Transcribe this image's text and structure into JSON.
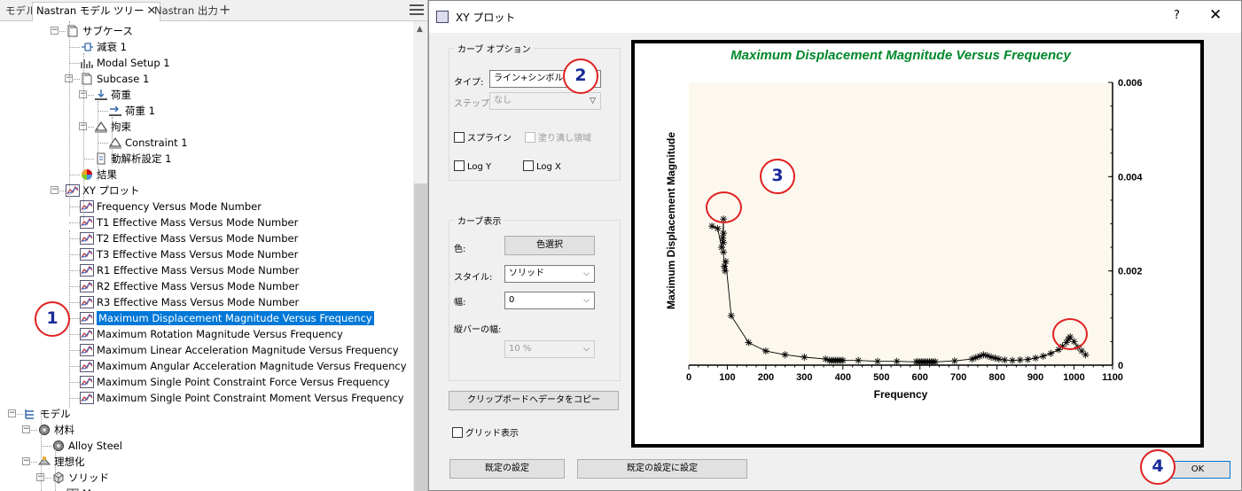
{
  "tabs": [
    {
      "label": "モデル"
    },
    {
      "label": "Nastran モデル ツリー",
      "close": "✕"
    },
    {
      "label": "Nastran 出力"
    }
  ],
  "tab_add": "+",
  "tree": [
    {
      "label": "サブケース",
      "icon": "subcase-icon"
    },
    {
      "label": "減衰 1",
      "icon": "damping-icon"
    },
    {
      "label": "Modal Setup 1",
      "icon": "modal-setup-icon"
    },
    {
      "label": "Subcase 1",
      "icon": "subcase-icon"
    },
    {
      "label": "荷重",
      "icon": "load-icon"
    },
    {
      "label": "荷重 1",
      "icon": "load-item-icon"
    },
    {
      "label": "拘束",
      "icon": "constraint-icon"
    },
    {
      "label": "Constraint 1",
      "icon": "constraint-item-icon"
    },
    {
      "label": "動解析設定 1",
      "icon": "dynamic-settings-icon"
    },
    {
      "label": "結果",
      "icon": "results-icon"
    },
    {
      "label": "XY プロット",
      "icon": "xy-plot-icon"
    },
    {
      "label": "Frequency Versus Mode Number",
      "icon": "plot-icon"
    },
    {
      "label": "T1 Effective Mass Versus Mode Number",
      "icon": "plot-icon"
    },
    {
      "label": "T2 Effective Mass Versus Mode Number",
      "icon": "plot-icon"
    },
    {
      "label": "T3 Effective Mass Versus Mode Number",
      "icon": "plot-icon"
    },
    {
      "label": "R1 Effective Mass Versus Mode Number",
      "icon": "plot-icon"
    },
    {
      "label": "R2 Effective Mass Versus Mode Number",
      "icon": "plot-icon"
    },
    {
      "label": "R3 Effective Mass Versus Mode Number",
      "icon": "plot-icon"
    },
    {
      "label": "Maximum Displacement Magnitude Versus Frequency",
      "icon": "plot-icon",
      "selected": true
    },
    {
      "label": "Maximum Rotation Magnitude Versus Frequency",
      "icon": "plot-icon"
    },
    {
      "label": "Maximum Linear Acceleration Magnitude Versus Frequency",
      "icon": "plot-icon"
    },
    {
      "label": "Maximum Angular Acceleration Magnitude Versus Frequency",
      "icon": "plot-icon"
    },
    {
      "label": "Maximum Single Point Constraint Force Versus Frequency",
      "icon": "plot-icon"
    },
    {
      "label": "Maximum Single Point Constraint Moment Versus Frequency",
      "icon": "plot-icon"
    },
    {
      "label": "モデル",
      "icon": "model-icon"
    },
    {
      "label": "材料",
      "icon": "materials-icon"
    },
    {
      "label": "Alloy Steel",
      "icon": "material-icon"
    },
    {
      "label": "理想化",
      "icon": "idealization-icon"
    },
    {
      "label": "ソリッド",
      "icon": "solid-icon"
    },
    {
      "label": "M",
      "icon": "mesh-icon"
    }
  ],
  "dialog": {
    "title": "XY プロット",
    "help": "?",
    "close": "✕",
    "curve_options": {
      "title": "カーブ オプション",
      "type_label": "タイプ:",
      "type_value": "ライン+シンボル",
      "step_label": "ステップ:",
      "step_value": "なし",
      "spline": "スプライン",
      "fill_area": "塗り潰し領域",
      "log_y": "Log Y",
      "log_x": "Log X"
    },
    "curve_display": {
      "title": "カーブ表示",
      "color_label": "色:",
      "color_button": "色選択",
      "style_label": "スタイル:",
      "style_value": "ソリッド",
      "width_label": "幅:",
      "width_value": "0",
      "errbar_label": "縦バーの幅:",
      "errbar_value": "10 %",
      "copy_button": "クリップボードへデータをコピー"
    },
    "grid_label": "グリッド表示",
    "default_settings": "既定の設定",
    "set_as_default": "既定の設定に設定",
    "ok": "OK"
  },
  "callouts": [
    "1",
    "2",
    "3",
    "4"
  ],
  "colors": {
    "title_green": "#00882b",
    "plot_bg": "#fcf8ee",
    "selection": "#0078d7",
    "callout_ring": "#e02020",
    "callout_text": "#1a2a9a"
  },
  "chart_data": {
    "type": "line",
    "title": "Maximum Displacement Magnitude Versus Frequency",
    "xlabel": "Frequency",
    "ylabel": "Maximum Displacement Magnitude",
    "xlim": [
      0,
      1100
    ],
    "ylim": [
      0,
      0.006
    ],
    "xticks": [
      "0",
      "100",
      "200",
      "300",
      "400",
      "500",
      "600",
      "700",
      "800",
      "900",
      "1000",
      "1100"
    ],
    "yticks": [
      "0",
      "0.002",
      "0.004",
      "0.006"
    ],
    "y_axis_side": "right",
    "marker": "asterisk",
    "grid": false,
    "series": [
      {
        "x": [
          60,
          75,
          85,
          88,
          90,
          90,
          90,
          90,
          92,
          94,
          96,
          110,
          155,
          200,
          250,
          300,
          355,
          365,
          370,
          375,
          380,
          385,
          390,
          395,
          400,
          440,
          490,
          540,
          590,
          595,
          600,
          605,
          610,
          615,
          620,
          625,
          630,
          635,
          640,
          690,
          735,
          745,
          755,
          765,
          775,
          785,
          795,
          805,
          820,
          840,
          860,
          880,
          900,
          920,
          940,
          960,
          970,
          980,
          985,
          990,
          1000,
          1010,
          1020,
          1030
        ],
        "y": [
          0.00295,
          0.0029,
          0.0025,
          0.0027,
          0.0031,
          0.0028,
          0.0026,
          0.0024,
          0.0021,
          0.002,
          0.0022,
          0.00105,
          0.00048,
          0.0003,
          0.00022,
          0.00017,
          0.00013,
          0.0001,
          0.0001,
          0.0001,
          0.0001,
          0.0001,
          0.0001,
          0.0001,
          0.0001,
          0.0001,
          8e-05,
          8e-05,
          7e-05,
          7e-05,
          7e-05,
          7e-05,
          7e-05,
          7e-05,
          7e-05,
          7e-05,
          7e-05,
          7e-05,
          7e-05,
          9e-05,
          0.00013,
          0.00016,
          0.00019,
          0.00022,
          0.0002,
          0.00017,
          0.00015,
          0.00013,
          0.00011,
          0.0001,
          0.00011,
          0.00012,
          0.00015,
          0.00019,
          0.00025,
          0.00033,
          0.0004,
          0.00048,
          0.00055,
          0.0006,
          0.0005,
          0.00038,
          0.0003,
          0.00022
        ]
      }
    ]
  }
}
